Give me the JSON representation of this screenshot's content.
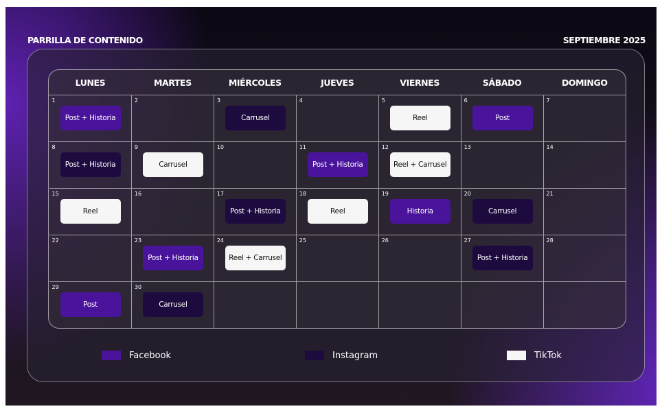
{
  "header": {
    "title": "PARRILLA DE CONTENIDO",
    "month": "SEPTIEMBRE 2025"
  },
  "calendar": {
    "days": [
      "LUNES",
      "MARTES",
      "MIÉRCOLES",
      "JUEVES",
      "VIERNES",
      "SÁBADO",
      "DOMINGO"
    ],
    "weeks": [
      [
        {
          "day": "1",
          "post": "Post + Historia",
          "platform": "Facebook"
        },
        {
          "day": "2",
          "post": "",
          "platform": ""
        },
        {
          "day": "3",
          "post": "Carrusel",
          "platform": "Instagram"
        },
        {
          "day": "4",
          "post": "",
          "platform": ""
        },
        {
          "day": "5",
          "post": "Reel",
          "platform": "TikTok"
        },
        {
          "day": "6",
          "post": "Post",
          "platform": "Facebook"
        },
        {
          "day": "7",
          "post": "",
          "platform": ""
        }
      ],
      [
        {
          "day": "8",
          "post": "Post + Historia",
          "platform": "Instagram"
        },
        {
          "day": "9",
          "post": "Carrusel",
          "platform": "TikTok"
        },
        {
          "day": "10",
          "post": "",
          "platform": ""
        },
        {
          "day": "11",
          "post": "Post + Historia",
          "platform": "Facebook"
        },
        {
          "day": "12",
          "post": "Reel + Carrusel",
          "platform": "TikTok"
        },
        {
          "day": "13",
          "post": "",
          "platform": ""
        },
        {
          "day": "14",
          "post": "",
          "platform": ""
        }
      ],
      [
        {
          "day": "15",
          "post": "Reel",
          "platform": "TikTok"
        },
        {
          "day": "16",
          "post": "",
          "platform": ""
        },
        {
          "day": "17",
          "post": "Post + Historia",
          "platform": "Instagram"
        },
        {
          "day": "18",
          "post": "Reel",
          "platform": "TikTok"
        },
        {
          "day": "19",
          "post": "Historia",
          "platform": "Facebook"
        },
        {
          "day": "20",
          "post": "Carrusel",
          "platform": "Instagram"
        },
        {
          "day": "21",
          "post": "",
          "platform": ""
        }
      ],
      [
        {
          "day": "22",
          "post": "",
          "platform": ""
        },
        {
          "day": "23",
          "post": "Post + Historia",
          "platform": "Facebook"
        },
        {
          "day": "24",
          "post": "Reel + Carrusel",
          "platform": "TikTok"
        },
        {
          "day": "25",
          "post": "",
          "platform": ""
        },
        {
          "day": "26",
          "post": "",
          "platform": ""
        },
        {
          "day": "27",
          "post": "Post + Historia",
          "platform": "Instagram"
        },
        {
          "day": "28",
          "post": "",
          "platform": ""
        }
      ],
      [
        {
          "day": "29",
          "post": "Post",
          "platform": "Facebook"
        },
        {
          "day": "30",
          "post": "Carrusel",
          "platform": "Instagram"
        },
        {
          "day": "",
          "post": "",
          "platform": ""
        },
        {
          "day": "",
          "post": "",
          "platform": ""
        },
        {
          "day": "",
          "post": "",
          "platform": ""
        },
        {
          "day": "",
          "post": "",
          "platform": ""
        },
        {
          "day": "",
          "post": "",
          "platform": ""
        }
      ]
    ]
  },
  "legend": [
    {
      "label": "Facebook",
      "color": "#4a139c"
    },
    {
      "label": "Instagram",
      "color": "#1d0b3f"
    },
    {
      "label": "TikTok",
      "color": "#f6f6f6"
    }
  ],
  "colors": {
    "facebook": "#4a139c",
    "instagram": "#1d0b3f",
    "tiktok": "#f6f6f6",
    "background_glow": "#6a1fd6"
  }
}
